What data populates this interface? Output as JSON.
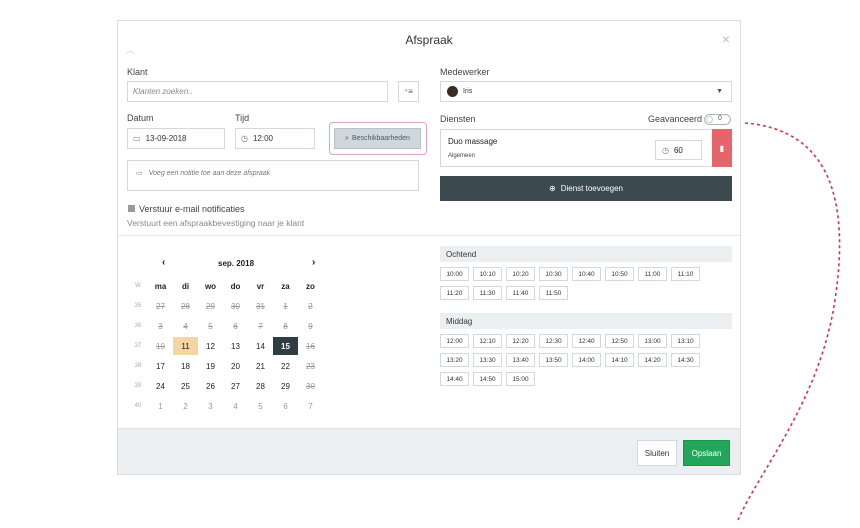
{
  "modal": {
    "title": "Afspraak",
    "close_glyph": "×"
  },
  "left": {
    "klant_label": "Klant",
    "klant_placeholder": "Klanten zoeken..",
    "datum_label": "Datum",
    "datum_value": "13-09-2018",
    "tijd_label": "Tijd",
    "tijd_value": "12:00",
    "beschik_label": "Beschikbaarheden",
    "note_placeholder": "Voeg een notitie toe aan deze afspraak",
    "email_label": "Verstuur e-mail notificaties",
    "email_sub": "Verstuurt een afspraakbevestiging naar je klant"
  },
  "right": {
    "medewerker_label": "Medewerker",
    "medewerker_value": "Iris",
    "diensten_label": "Diensten",
    "geavanceerd_label": "Geavanceerd",
    "toggle_state": "0",
    "service": {
      "name": "Duo massage",
      "category": "Algemeen",
      "duration": "60"
    },
    "add_service_label": "Dienst toevoegen"
  },
  "calendar": {
    "month": "sep. 2018",
    "prev": "‹",
    "next": "›",
    "headers": [
      "W",
      "ma",
      "di",
      "wo",
      "do",
      "vr",
      "za",
      "zo"
    ],
    "weeks": [
      {
        "wk": "35",
        "days": [
          "27",
          "28",
          "29",
          "30",
          "31",
          "1",
          "2"
        ]
      },
      {
        "wk": "36",
        "days": [
          "3",
          "4",
          "5",
          "6",
          "7",
          "8",
          "9"
        ]
      },
      {
        "wk": "37",
        "days": [
          "10",
          "11",
          "12",
          "13",
          "14",
          "15",
          "16"
        ]
      },
      {
        "wk": "38",
        "days": [
          "17",
          "18",
          "19",
          "20",
          "21",
          "22",
          "23"
        ]
      },
      {
        "wk": "39",
        "days": [
          "24",
          "25",
          "26",
          "27",
          "28",
          "29",
          "30"
        ]
      },
      {
        "wk": "40",
        "days": [
          "1",
          "2",
          "3",
          "4",
          "5",
          "6",
          "7"
        ]
      }
    ]
  },
  "slots": {
    "morning_label": "Ochtend",
    "morning": [
      "10:00",
      "10:10",
      "10:20",
      "10:30",
      "10:40",
      "10:50",
      "11:00",
      "11:10",
      "11:20",
      "11:30",
      "11:40",
      "11:50"
    ],
    "afternoon_label": "Middag",
    "afternoon": [
      "12:00",
      "12:10",
      "12:20",
      "12:30",
      "12:40",
      "12:50",
      "13:00",
      "13:10",
      "13:20",
      "13:30",
      "13:40",
      "13:50",
      "14:00",
      "14:10",
      "14:20",
      "14:30",
      "14:40",
      "14:50",
      "15:00"
    ]
  },
  "footer": {
    "sluiten": "Sluiten",
    "opslaan": "Opslaan"
  },
  "colors": {
    "primary_green": "#23a55a",
    "dark_button": "#3c4a50",
    "delete_red": "#e6656d",
    "highlight_pink": "#e0a2c6",
    "dashed_red": "#e0303f"
  }
}
